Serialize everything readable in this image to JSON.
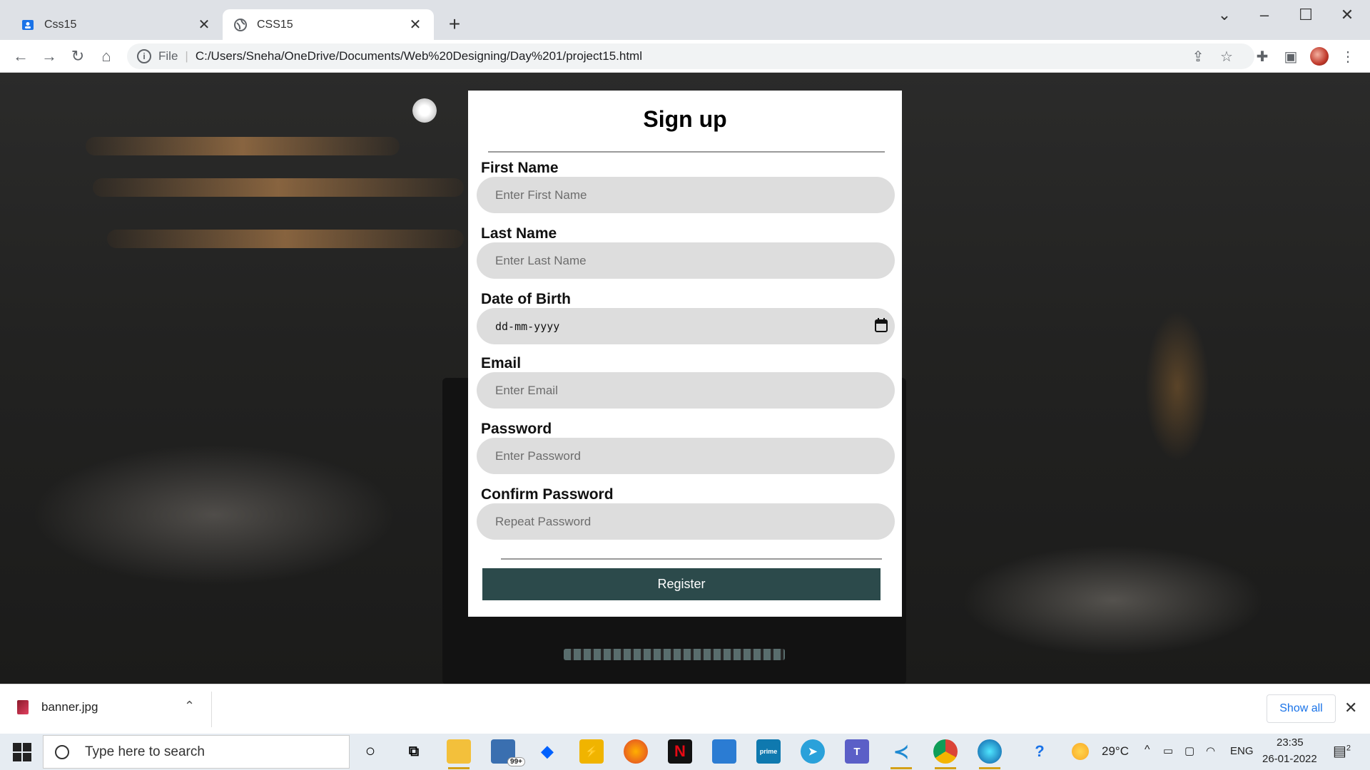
{
  "browser": {
    "tabs": [
      {
        "title": "Css15",
        "active": false
      },
      {
        "title": "CSS15",
        "active": true
      }
    ],
    "address": {
      "scheme_label": "File",
      "url": "C:/Users/Sneha/OneDrive/Documents/Web%20Designing/Day%201/project15.html"
    }
  },
  "form": {
    "title": "Sign up",
    "fields": [
      {
        "label": "First Name",
        "placeholder": "Enter First Name"
      },
      {
        "label": "Last Name",
        "placeholder": "Enter Last Name"
      },
      {
        "label": "Date of Birth",
        "placeholder": "dd-mm-yyyy"
      },
      {
        "label": "Email",
        "placeholder": "Enter Email"
      },
      {
        "label": "Password",
        "placeholder": "Enter Password"
      },
      {
        "label": "Confirm Password",
        "placeholder": "Repeat Password"
      }
    ],
    "register_label": "Register",
    "button_color": "#2c4a4b"
  },
  "downloads": {
    "file_name": "banner.jpg",
    "show_all_label": "Show all"
  },
  "taskbar": {
    "search_placeholder": "Type here to search",
    "mail_badge": "99+",
    "temperature": "29°C",
    "language": "ENG",
    "time": "23:35",
    "date": "26-01-2022",
    "notification_count": "2"
  }
}
